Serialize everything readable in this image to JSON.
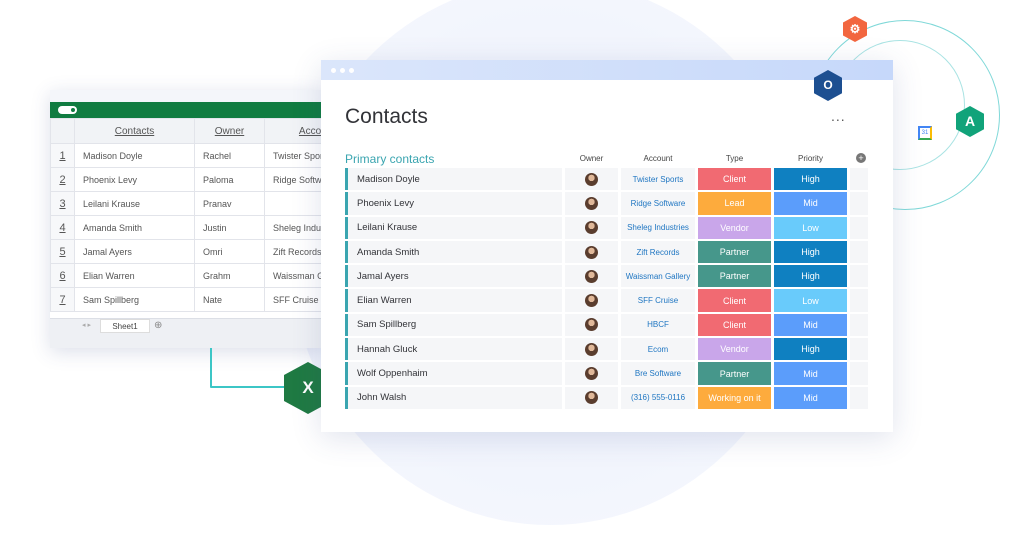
{
  "excel": {
    "columns": [
      "Contacts",
      "Owner",
      "Account"
    ],
    "rows": [
      {
        "n": "1",
        "contact": "Madison Doyle",
        "owner": "Rachel",
        "account": "Twister Sports"
      },
      {
        "n": "2",
        "contact": "Phoenix Levy",
        "owner": "Paloma",
        "account": "Ridge Software"
      },
      {
        "n": "3",
        "contact": "Leilani Krause",
        "owner": "Pranav",
        "account": ""
      },
      {
        "n": "4",
        "contact": "Amanda Smith",
        "owner": "Justin",
        "account": "Sheleg Industries"
      },
      {
        "n": "5",
        "contact": "Jamal Ayers",
        "owner": "Omri",
        "account": "Zift Records"
      },
      {
        "n": "6",
        "contact": "Elian Warren",
        "owner": "Grahm",
        "account": "Waissman Gallery"
      },
      {
        "n": "7",
        "contact": "Sam Spillberg",
        "owner": "Nate",
        "account": "SFF Cruise"
      }
    ],
    "sheet_tab": "Sheet1",
    "logo": "X"
  },
  "board": {
    "title": "Contacts",
    "more": "...",
    "group": "Primary contacts",
    "headers": {
      "owner": "Owner",
      "account": "Account",
      "type": "Type",
      "priority": "Priority"
    },
    "add": "+",
    "colors": {
      "Client": "#f16a72",
      "Lead": "#fdab3d",
      "Vendor": "#c9a6ea",
      "Partner": "#46978b",
      "Working on it": "#fdab3d",
      "High": "#0f80c1",
      "Mid": "#5b9dfb",
      "Low": "#69cbfb",
      "group": "#3aa5b0"
    },
    "rows": [
      {
        "name": "Madison Doyle",
        "account": "Twister Sports",
        "type": "Client",
        "priority": "High"
      },
      {
        "name": "Phoenix Levy",
        "account": "Ridge Software",
        "type": "Lead",
        "priority": "Mid"
      },
      {
        "name": "Leilani Krause",
        "account": "Sheleg Industries",
        "type": "Vendor",
        "priority": "Low"
      },
      {
        "name": "Amanda Smith",
        "account": "Zift Records",
        "type": "Partner",
        "priority": "High"
      },
      {
        "name": "Jamal Ayers",
        "account": "Waissman Gallery",
        "type": "Partner",
        "priority": "High"
      },
      {
        "name": "Elian Warren",
        "account": "SFF Cruise",
        "type": "Client",
        "priority": "Low"
      },
      {
        "name": "Sam Spillberg",
        "account": "HBCF",
        "type": "Client",
        "priority": "Mid"
      },
      {
        "name": "Hannah Gluck",
        "account": "Ecom",
        "type": "Vendor",
        "priority": "High"
      },
      {
        "name": "Wolf Oppenhaim",
        "account": "Bre Software",
        "type": "Partner",
        "priority": "Mid"
      },
      {
        "name": "John Walsh",
        "account": "(316) 555-0116",
        "type": "Working on it",
        "priority": "Mid"
      }
    ]
  },
  "integrations": [
    "hubspot-icon",
    "outlook-icon",
    "google-calendar-icon",
    "aha-icon",
    "excel-icon"
  ]
}
